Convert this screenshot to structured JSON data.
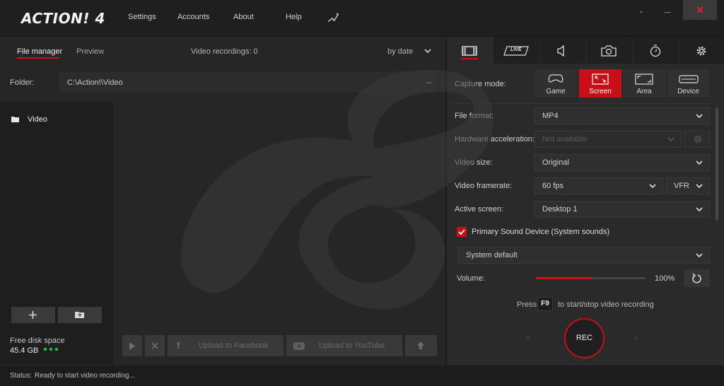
{
  "app": {
    "logo_text": "ACTION! 4"
  },
  "menu": {
    "settings": "Settings",
    "accounts": "Accounts",
    "about": "About",
    "help": "Help"
  },
  "window_controls": {
    "minimize": "-",
    "maximize": "—",
    "close": "✕"
  },
  "file_manager": {
    "tab_file_manager": "File manager",
    "tab_preview": "Preview",
    "recordings_count": "Video recordings: 0",
    "sort": "by date",
    "folder_label": "Folder:",
    "folder_path": "C:\\Action!\\Video",
    "folder_more": "...",
    "tree_items": [
      "Video"
    ],
    "free_disk_label": "Free disk space",
    "free_disk_value": "45.4 GB",
    "upload_facebook": "Upload to Facebook",
    "upload_youtube": "Upload to YouTube"
  },
  "capture": {
    "mode_label": "Capture mode:",
    "modes": [
      "Game",
      "Screen",
      "Area",
      "Device"
    ],
    "selected_mode": "Screen",
    "live_tab": "LIVE",
    "settings": {
      "file_format_label": "File format:",
      "file_format_value": "MP4",
      "hw_accel_label": "Hardware acceleration:",
      "hw_accel_value": "Not available",
      "video_size_label": "Video size:",
      "video_size_value": "Original",
      "framerate_label": "Video framerate:",
      "framerate_value": "60 fps",
      "framerate_mode": "VFR",
      "active_screen_label": "Active screen:",
      "active_screen_value": "Desktop 1",
      "sound_device": "Primary Sound Device (System sounds)",
      "sound_source": "System default",
      "volume_label": "Volume:",
      "volume_value": "100%",
      "volume_level": 0.5
    },
    "hotkey_press": "Press",
    "hotkey_key": "F9",
    "hotkey_desc": "to start/stop video recording",
    "rec_label": "REC"
  },
  "status": {
    "label": "Status:",
    "text": "Ready to start video recording..."
  },
  "colors": {
    "accent": "#d0111b",
    "bg": "#252525"
  }
}
